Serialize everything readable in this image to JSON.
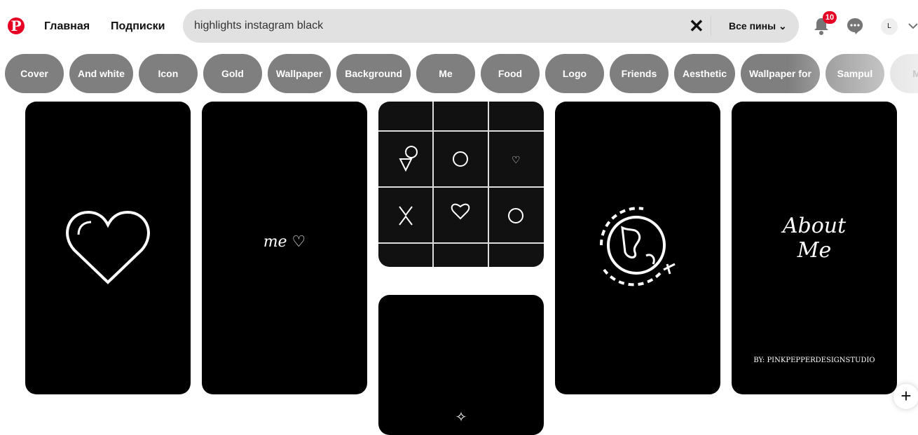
{
  "header": {
    "logo": "P",
    "nav": [
      "Главная",
      "Подписки"
    ],
    "search": {
      "value": "highlights instagram black",
      "filter": "Все пины"
    },
    "notifications_count": "10",
    "avatar_initial": "L"
  },
  "chips": [
    "Cover",
    "And white",
    "Icon",
    "Gold",
    "Wallpaper",
    "Background",
    "Me",
    "Food",
    "Logo",
    "Friends",
    "Aesthetic",
    "Wallpaper for",
    "Sampul",
    "Me"
  ],
  "pins": {
    "me_text": "me ♡",
    "about_line1": "About",
    "about_line2": "Me",
    "credit": "BY: PINKPEPPERDESIGNSTUDIO"
  },
  "colors": {
    "brand": "#e60023",
    "chip": "#7f7f7f",
    "search": "#e1e1e1"
  }
}
